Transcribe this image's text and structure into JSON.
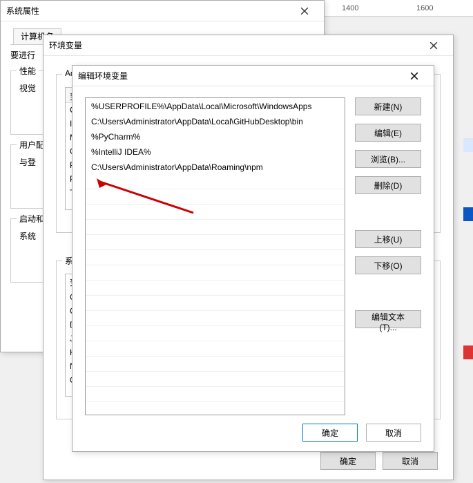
{
  "ruler": {
    "t1": "1400",
    "t2": "1600"
  },
  "d1": {
    "title": "系统属性",
    "tab_computer": "计算机名",
    "label_proceed": "要进行",
    "group_perf": "性能",
    "label_visual": "视觉",
    "group_user": "用户配",
    "label_login": "与登",
    "group_startup": "启动和",
    "label_system": "系统"
  },
  "d2": {
    "title": "环境变量",
    "admin_group": "Adm",
    "sys_group": "系统",
    "hdr_var": "变",
    "user_vars": [
      "Ch",
      "In",
      "M",
      "O",
      "Pa",
      "Py",
      "TE"
    ],
    "sys_vars": [
      "变",
      "Ch",
      "Co",
      "Dr",
      "JA",
      "KL",
      "NU",
      "O"
    ],
    "ok": "确定",
    "cancel": "取消"
  },
  "d3": {
    "title": "编辑环境变量",
    "paths": [
      "%USERPROFILE%\\AppData\\Local\\Microsoft\\WindowsApps",
      "C:\\Users\\Administrator\\AppData\\Local\\GitHubDesktop\\bin",
      "%PyCharm%",
      "%IntelliJ IDEA%",
      "C:\\Users\\Administrator\\AppData\\Roaming\\npm"
    ],
    "btn_new": "新建(N)",
    "btn_edit": "编辑(E)",
    "btn_browse": "浏览(B)...",
    "btn_delete": "删除(D)",
    "btn_up": "上移(U)",
    "btn_down": "下移(O)",
    "btn_edittext": "编辑文本(T)...",
    "ok": "确定",
    "cancel": "取消"
  }
}
